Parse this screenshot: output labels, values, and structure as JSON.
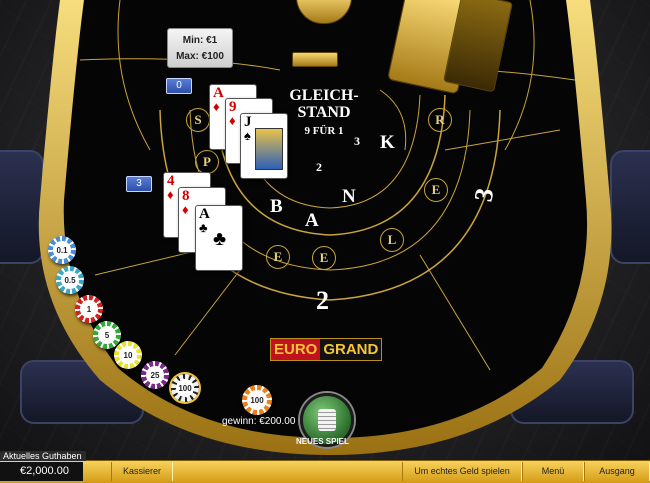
{
  "limits": {
    "min": "Min: €1",
    "max": "Max: €100"
  },
  "bets": {
    "player_count": "0",
    "bank_count": "3"
  },
  "table_text": {
    "tie_line1": "GLEICH-",
    "tie_line2": "STAND",
    "tie_payout": "9 FÜR 1",
    "seat_2": "2",
    "seat_3": "3",
    "bank_small_2": "2",
    "bank_small_3": "3"
  },
  "ring_letters_player": [
    "S",
    "P",
    "I",
    "E",
    "L",
    "E",
    "R"
  ],
  "ring_letters_bank": [
    "B",
    "A",
    "N",
    "K"
  ],
  "player_cards": [
    {
      "rank": "A",
      "suit": "♦",
      "color": "#d40000"
    },
    {
      "rank": "9",
      "suit": "♦",
      "color": "#d40000"
    },
    {
      "rank": "J",
      "suit": "♠",
      "color": "#000000"
    }
  ],
  "bank_cards": [
    {
      "rank": "4",
      "suit": "♦",
      "color": "#d40000"
    },
    {
      "rank": "8",
      "suit": "♦",
      "color": "#d40000"
    },
    {
      "rank": "A",
      "suit": "♣",
      "color": "#000000"
    }
  ],
  "chips": [
    {
      "value": "0.1",
      "color": "#4b8ed8"
    },
    {
      "value": "0.5",
      "color": "#3aa8c8"
    },
    {
      "value": "1",
      "color": "#d42020"
    },
    {
      "value": "5",
      "color": "#35a83a"
    },
    {
      "value": "10",
      "color": "#e9e032"
    },
    {
      "value": "25",
      "color": "#7a2a8a"
    },
    {
      "value": "100",
      "color": "#f0f0f0"
    }
  ],
  "bet_stack_value": "100",
  "win_text": "gewinn: €200.00",
  "new_game_label": "NEUES SPIEL",
  "logo": {
    "part1": "EURO",
    "part2": "GRAND"
  },
  "footer": {
    "balance_title": "Aktuelles Guthaben",
    "balance": "€2,000.00",
    "cashier": "Kassierer",
    "real_money": "Um echtes Geld spielen",
    "menu": "Menü",
    "exit": "Ausgang"
  },
  "colors": {
    "felt": "#050505",
    "gold": "#c9a43a",
    "footer": "#e8b935"
  }
}
